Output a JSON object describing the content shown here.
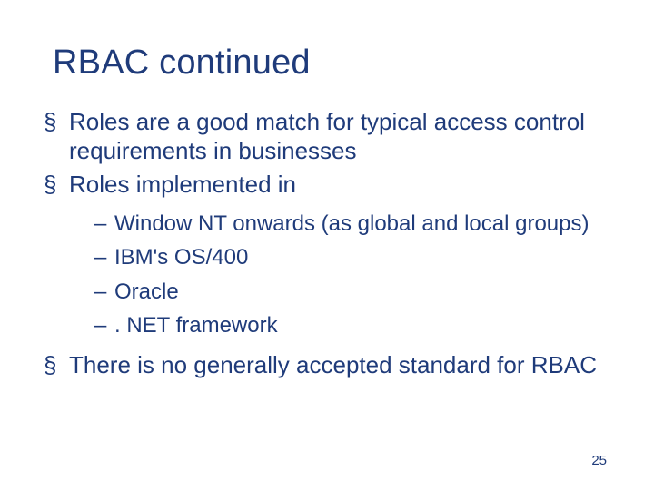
{
  "title": "RBAC continued",
  "bullets": [
    {
      "text": "Roles are a good match for typical access control requirements in businesses"
    },
    {
      "text": "Roles implemented in",
      "sub": [
        "Window NT onwards (as global and local groups)",
        "IBM's OS/400",
        "Oracle",
        ". NET framework"
      ]
    },
    {
      "text": "There is no generally accepted standard for RBAC"
    }
  ],
  "page_number": "25"
}
